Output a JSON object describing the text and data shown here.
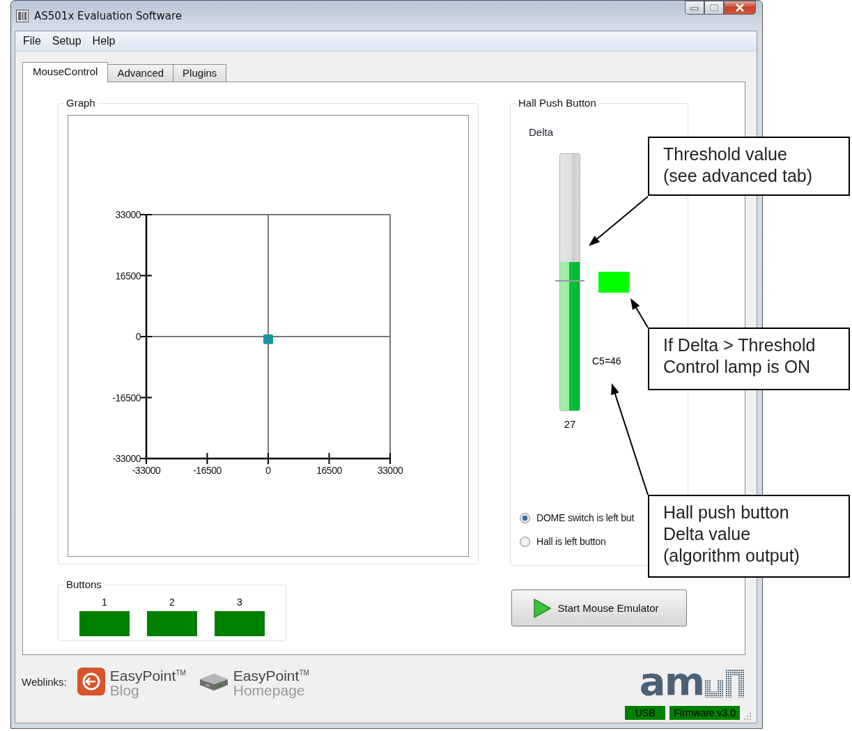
{
  "window": {
    "title": "AS501x Evaluation Software"
  },
  "menu": [
    "File",
    "Setup",
    "Help"
  ],
  "tabs": [
    {
      "label": "MouseControl",
      "selected": true
    },
    {
      "label": "Advanced",
      "selected": false
    },
    {
      "label": "Plugins",
      "selected": false
    }
  ],
  "graph": {
    "title": "Graph",
    "chart_data": {
      "type": "scatter",
      "x": [
        0
      ],
      "series": [
        {
          "color": "#16999b",
          "values": [
            -700
          ]
        }
      ],
      "xlim": [
        -33000,
        33000
      ],
      "ylim": [
        -33000,
        33000
      ],
      "xticks": [
        -33000,
        -16500,
        0,
        16500,
        33000
      ],
      "yticks": [
        -33000,
        -16500,
        0,
        16500,
        33000
      ]
    }
  },
  "buttons": {
    "title": "Buttons",
    "items": [
      {
        "label": "1",
        "pressed": false
      },
      {
        "label": "2",
        "pressed": false
      },
      {
        "label": "3",
        "pressed": false
      }
    ]
  },
  "hall": {
    "title": "Hall Push Button",
    "delta_label": "Delta",
    "delta": {
      "level": 0.58
    },
    "threshold": {
      "level": 0.5
    },
    "delta_value": "27",
    "lamp": {
      "on": true
    },
    "reading": "C5=46",
    "options": [
      {
        "label": "DOME switch is left but",
        "selected": true
      },
      {
        "label": "Hall is left button",
        "selected": false
      }
    ]
  },
  "start_button": {
    "label": "Start Mouse Emulator"
  },
  "weblinks": {
    "label": "Weblinks:",
    "links": [
      {
        "kind": "blog",
        "title": "EasyPoint$^{TM}$",
        "subtitle": "Blog"
      },
      {
        "kind": "homepage",
        "title": "EasyPoint$^{TM}$",
        "subtitle": "Homepage"
      }
    ]
  },
  "logo": {
    "text": "am"
  },
  "status_bar": [
    "USB",
    "Firmware v3.0"
  ],
  "callouts": [
    {
      "text": "Threshold value\n(see advanced tab)"
    },
    {
      "text": "If Delta > Threshold\nControl lamp is ON"
    },
    {
      "text": "Hall push button\nDelta value\n(algorithm output)"
    }
  ]
}
